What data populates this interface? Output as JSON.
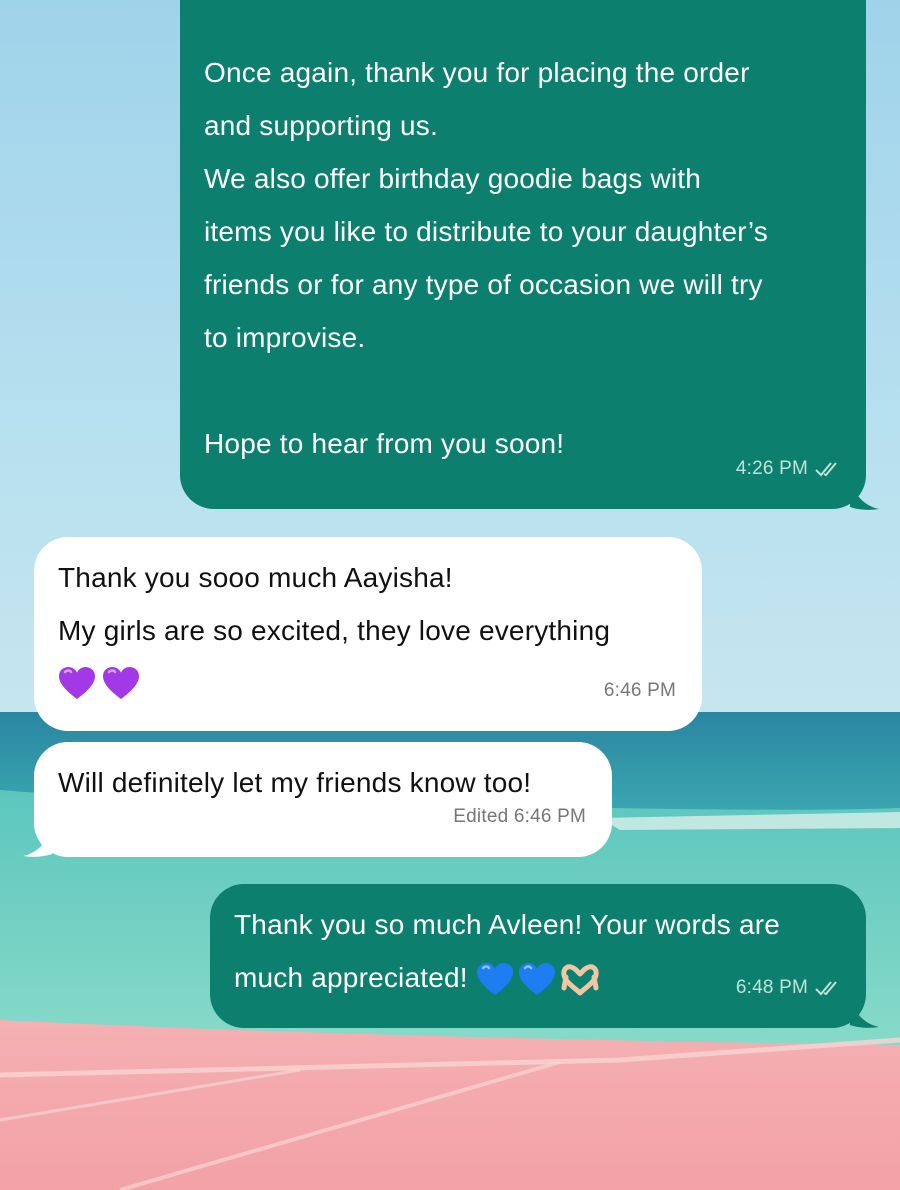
{
  "colors": {
    "outgoing_bubble": "#0d7f6e",
    "incoming_bubble": "#ffffff",
    "sky_top": "#9fd3ea",
    "sea": "#2e93a5",
    "lagoon": "#6ccfc3",
    "salt_flats": "#f3a7ab"
  },
  "messages": [
    {
      "direction": "outgoing",
      "text": "Once again, thank you for placing the order\nand supporting us.\nWe also offer birthday goodie bags with\nitems you like to distribute to your daughter’s\nfriends or for any type of occasion we will try\nto improvise.\n\nHope to hear from you soon!",
      "time": "4:26 PM",
      "status_icon": "double-check-icon"
    },
    {
      "direction": "incoming",
      "text": "Thank you sooo much Aayisha!\nMy girls are so excited, they love everything",
      "emojis": [
        "purple-heart-icon",
        "purple-heart-icon"
      ],
      "time": "6:46 PM"
    },
    {
      "direction": "incoming",
      "text": "Will definitely let my friends know too!",
      "time": "Edited 6:46 PM"
    },
    {
      "direction": "outgoing",
      "text": "Thank you so much Avleen! Your words are\nmuch appreciated!",
      "emojis": [
        "blue-heart-icon",
        "blue-heart-icon",
        "heart-hands-icon"
      ],
      "time": "6:48 PM",
      "status_icon": "double-check-icon"
    }
  ]
}
